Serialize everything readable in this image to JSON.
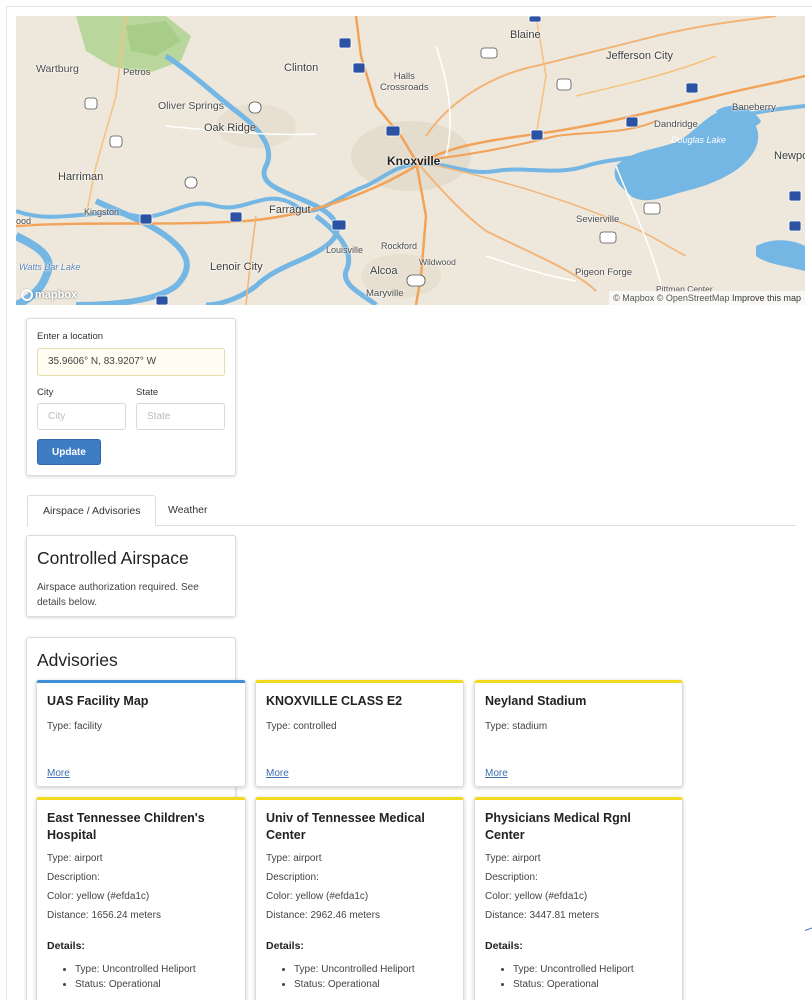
{
  "map": {
    "labels": {
      "blaine": "Blaine",
      "jefferson_city": "Jefferson City",
      "wartburg": "Wartburg",
      "petros": "Petros",
      "clinton": "Clinton",
      "halls": "Halls\nCrossroads",
      "baneberry": "Baneberry",
      "oliver_springs": "Oliver Springs",
      "oak_ridge": "Oak Ridge",
      "dandridge": "Dandridge",
      "douglas_lake": "Douglas Lake",
      "newport": "Newpo",
      "knoxville": "Knoxville",
      "harriman": "Harriman",
      "kingston": "Kingston",
      "farragut": "Farragut",
      "sevierville": "Sevierville",
      "rockford": "Rockford",
      "louisville": "Louisville",
      "wood": "ood",
      "lenoir_city": "Lenoir City",
      "wildwood": "Wildwood",
      "alcoa": "Alcoa",
      "pigeon_forge": "Pigeon Forge",
      "watts_bar": "Watts Bar Lake",
      "maryville": "Maryville",
      "pittman": "Pittman Center"
    },
    "shields": [
      "75",
      "11W",
      "441",
      "27",
      "95",
      "11E",
      "81",
      "640",
      "40",
      "40",
      "27",
      "40",
      "95",
      "40",
      "140",
      "411",
      "40",
      "441",
      "411",
      "75",
      "321"
    ],
    "logo": "mapbox",
    "attribution": "© Mapbox © OpenStreetMap",
    "improve": "Improve this map"
  },
  "location": {
    "label": "Enter a location",
    "value": "35.9606° N, 83.9207° W",
    "city_label": "City",
    "city_placeholder": "City",
    "state_label": "State",
    "state_placeholder": "State",
    "update_button": "Update"
  },
  "tabs": [
    {
      "label": "Airspace / Advisories",
      "active": true
    },
    {
      "label": "Weather",
      "active": false
    }
  ],
  "controlled_airspace": {
    "title": "Controlled Airspace",
    "text": "Airspace authorization required. See details below."
  },
  "advisories": {
    "title": "Advisories",
    "cards": [
      {
        "name": "UAS Facility Map",
        "type": "Type: facility",
        "more": "More",
        "accent": "#3e8fd6"
      },
      {
        "name": "KNOXVILLE CLASS E2",
        "type": "Type: controlled",
        "more": "More",
        "accent": "#efda1c"
      },
      {
        "name": "Neyland Stadium",
        "type": "Type: stadium",
        "more": "More",
        "accent": "#efda1c"
      },
      {
        "name": "East Tennessee Children's Hospital",
        "type": "Type: airport",
        "description": "Description:",
        "color": "Color: yellow (#efda1c)",
        "distance": "Distance: 1656.24 meters",
        "details_label": "Details:",
        "details": [
          "Type: Uncontrolled Heliport",
          "Status: Operational"
        ]
      },
      {
        "name": "Univ of Tennessee Medical Center",
        "type": "Type: airport",
        "description": "Description:",
        "color": "Color: yellow (#efda1c)",
        "distance": "Distance: 2962.46 meters",
        "details_label": "Details:",
        "details": [
          "Type: Uncontrolled Heliport",
          "Status: Operational"
        ]
      },
      {
        "name": "Physicians Medical Rgnl Center",
        "type": "Type: airport",
        "description": "Description:",
        "color": "Color: yellow (#efda1c)",
        "distance": "Distance: 3447.81 meters",
        "details_label": "Details:",
        "details": [
          "Type: Uncontrolled Heliport",
          "Status: Operational"
        ]
      }
    ]
  }
}
